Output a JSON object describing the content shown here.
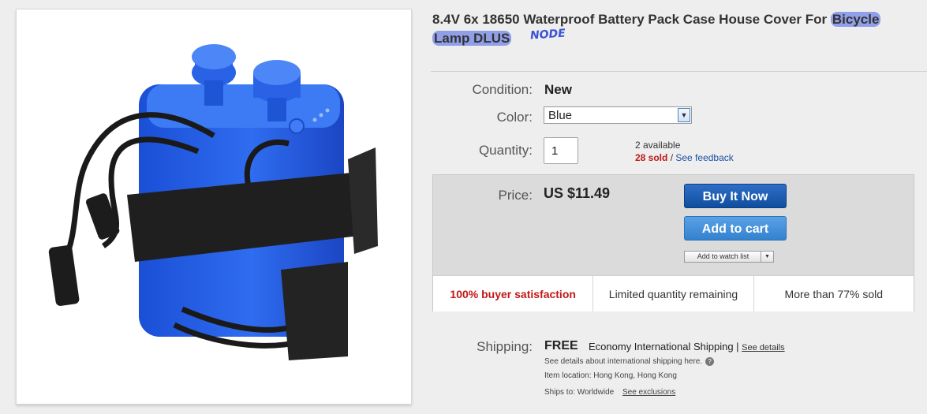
{
  "title": {
    "main": "8.4V 6x 18650 Waterproof Battery Pack Case House Cover For ",
    "highlighted_1": "Bicycle",
    "highlighted_2": "Lamp DLUS",
    "scribble": "NODE"
  },
  "condition": {
    "label": "Condition:",
    "value": "New"
  },
  "color": {
    "label": "Color:",
    "selected": "Blue"
  },
  "quantity": {
    "label": "Quantity:",
    "value": "1",
    "available": "2 available",
    "sold": "28 sold",
    "separator": " / ",
    "feedback_link": "See feedback"
  },
  "price": {
    "label": "Price:",
    "value": "US $11.49",
    "buy_now": "Buy It Now",
    "add_to_cart": "Add to cart",
    "watch_list": "Add to watch list"
  },
  "highlights": [
    "100% buyer satisfaction",
    "Limited quantity remaining",
    "More than 77% sold"
  ],
  "shipping": {
    "label": "Shipping:",
    "free": "FREE",
    "type": "Economy International Shipping",
    "sep": " | ",
    "details_link": "See details",
    "intl_note": "See details about international shipping here.",
    "location": "Item location:  Hong Kong, Hong Kong",
    "ships_to": "Ships to:  Worldwide",
    "exclusions_link": "See exclusions"
  },
  "colors": {
    "buy_button": "#0f4e9e",
    "cart_button": "#3481cf",
    "highlight_red": "#c01818",
    "link_blue": "#1b4fa3",
    "scribble_highlight": "#465fe6"
  }
}
